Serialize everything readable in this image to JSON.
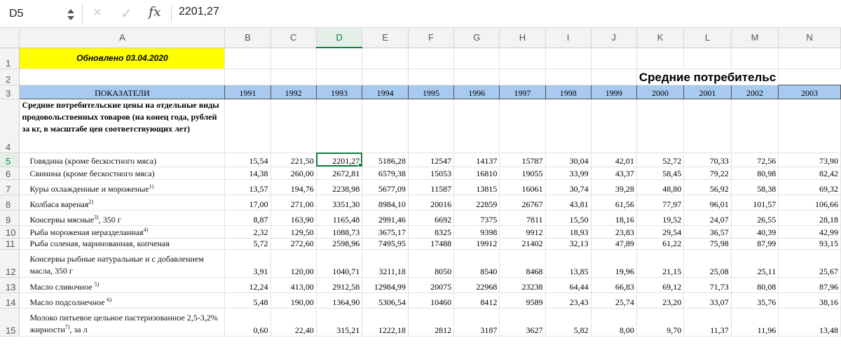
{
  "formula_bar": {
    "name_box": "D5",
    "cancel_icon": "×",
    "confirm_icon": "✓",
    "fx_label": "fx",
    "formula_value": "2201,27"
  },
  "columns": [
    "A",
    "B",
    "C",
    "D",
    "E",
    "F",
    "G",
    "H",
    "I",
    "J",
    "K",
    "L",
    "M",
    "N"
  ],
  "selected_column": "D",
  "selected_row": "5",
  "row_numbers": [
    "1",
    "2",
    "3",
    "4",
    "5",
    "6",
    "7",
    "8",
    "9",
    "10",
    "11",
    "12",
    "13",
    "14",
    "15"
  ],
  "sheet": {
    "updated": "Обновлено 03.04.2020",
    "title": "Средние потребительс",
    "header_label": "ПОКАЗАТЕЛИ",
    "years": [
      "1991",
      "1992",
      "1993",
      "1994",
      "1995",
      "1996",
      "1997",
      "1998",
      "1999",
      "2000",
      "2001",
      "2002",
      "2003"
    ],
    "section": "Средние потребительские цены на отдельные виды продовольственных товаров (на конец года, рублей за кг, в масштабе цен соответствующих лет)",
    "rows": [
      {
        "label": "Говядина (кроме бескостного мяса)",
        "sup": "",
        "tail": "",
        "values": [
          "15,54",
          "221,50",
          "2201,27",
          "5186,28",
          "12547",
          "14137",
          "15787",
          "30,04",
          "42,01",
          "52,72",
          "70,33",
          "72,56",
          "73,90"
        ]
      },
      {
        "label": "Свинина (кроме бескостного мяса)",
        "sup": "",
        "tail": "",
        "values": [
          "14,38",
          "260,00",
          "2672,81",
          "6579,38",
          "15053",
          "16810",
          "19055",
          "33,99",
          "43,37",
          "58,45",
          "79,22",
          "80,98",
          "82,42"
        ]
      },
      {
        "label": "Куры охлажденные и мороженые",
        "sup": "1)",
        "tail": "",
        "values": [
          "13,57",
          "194,76",
          "2238,98",
          "5677,09",
          "11587",
          "13815",
          "16061",
          "30,74",
          "39,28",
          "48,80",
          "56,92",
          "58,38",
          "69,32"
        ]
      },
      {
        "label": "Колбаса вареная",
        "sup": "2)",
        "tail": "",
        "values": [
          "17,00",
          "271,00",
          "3351,30",
          "8984,10",
          "20016",
          "22859",
          "26767",
          "43,81",
          "61,56",
          "77,97",
          "96,01",
          "101,57",
          "106,66"
        ]
      },
      {
        "label": "Консервы мясные",
        "sup": "3)",
        "tail": ", 350 г",
        "values": [
          "8,87",
          "163,90",
          "1165,48",
          "2991,46",
          "6692",
          "7375",
          "7811",
          "15,50",
          "18,16",
          "19,52",
          "24,07",
          "26,55",
          "28,18"
        ]
      },
      {
        "label": "Рыба мороженая неразделанная",
        "sup": "4)",
        "tail": "",
        "values": [
          "2,32",
          "129,50",
          "1088,73",
          "3675,17",
          "8325",
          "9398",
          "9912",
          "18,93",
          "23,83",
          "29,54",
          "36,57",
          "40,39",
          "42,99"
        ]
      },
      {
        "label": "Рыба соленая, маринованная, копченая",
        "sup": "",
        "tail": "",
        "values": [
          "5,72",
          "272,60",
          "2598,96",
          "7495,95",
          "17488",
          "19912",
          "21402",
          "32,13",
          "47,89",
          "61,22",
          "75,98",
          "87,99",
          "93,15"
        ]
      },
      {
        "label": "Консервы рыбные натуральные и с добавлением масла,  350 г",
        "sup": "",
        "tail": "",
        "values": [
          "3,91",
          "120,00",
          "1040,71",
          "3211,18",
          "8050",
          "8540",
          "8468",
          "13,85",
          "19,96",
          "21,15",
          "25,08",
          "25,11",
          "25,67"
        ]
      },
      {
        "label": "Масло сливочное ",
        "sup": "5)",
        "tail": "",
        "values": [
          "12,24",
          "413,00",
          "2912,58",
          "12984,99",
          "20075",
          "22968",
          "23238",
          "64,44",
          "66,83",
          "69,12",
          "71,73",
          "80,08",
          "87,96"
        ]
      },
      {
        "label": "Масло подсолнечное ",
        "sup": "6)",
        "tail": "",
        "values": [
          "5,48",
          "190,00",
          "1364,90",
          "5306,54",
          "10460",
          "8412",
          "9589",
          "23,43",
          "25,74",
          "23,20",
          "33,07",
          "35,76",
          "38,16"
        ]
      },
      {
        "label": "Молоко питьевое цельное  пастеризованное 2,5-3,2% жирности",
        "sup": "7)",
        "tail": ", за л",
        "values": [
          "0,60",
          "22,40",
          "315,21",
          "1222,18",
          "2812",
          "3187",
          "3627",
          "5,82",
          "8,00",
          "9,70",
          "11,37",
          "11,96",
          "13,48"
        ]
      }
    ]
  }
}
